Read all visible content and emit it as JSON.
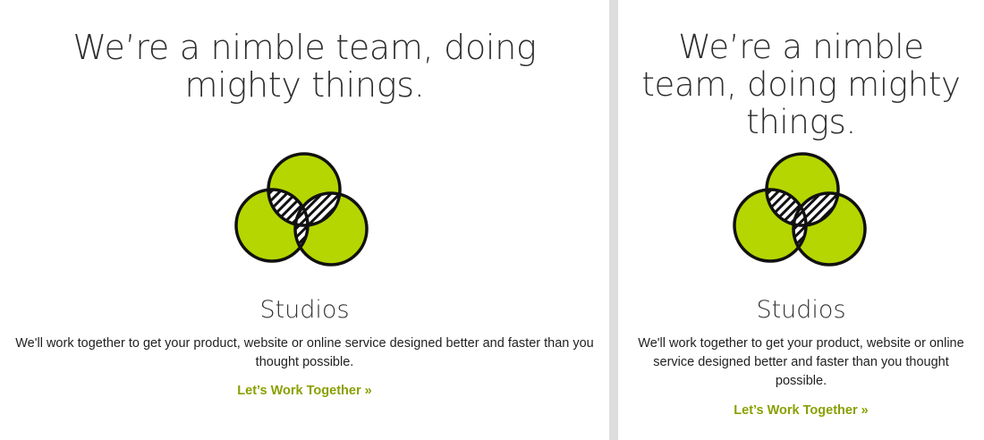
{
  "colors": {
    "accent": "#8aa000",
    "venn_fill": "#b5d600",
    "divider": "#dedede"
  },
  "left": {
    "headline": "We’re a nimble team, doing mighty things.",
    "icon": "venn-diagram-icon",
    "title": "Studios",
    "description": "We'll work together to get your product, website or online service designed better and faster than you thought possible.",
    "cta": "Let’s Work Together »"
  },
  "right": {
    "headline": "We’re a nimble team, doing mighty things.",
    "icon": "venn-diagram-icon",
    "title": "Studios",
    "description": "We'll work together to get your product, website or online service designed better and faster than you thought possible.",
    "cta": "Let’s Work Together »"
  }
}
